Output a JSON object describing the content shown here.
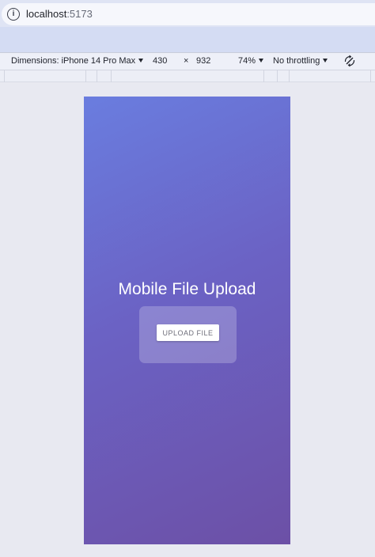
{
  "browser": {
    "url_host": "localhost",
    "url_port": ":5173",
    "info_icon": "info-icon"
  },
  "devtools": {
    "dimensions_label": "Dimensions: iPhone 14 Pro Max",
    "width": "430",
    "times": "×",
    "height": "932",
    "zoom": "74%",
    "throttling": "No throttling",
    "rotate_icon": "rotate-icon"
  },
  "app": {
    "title": "Mobile File Upload",
    "upload_button_label": "UPLOAD FILE",
    "gradient_start": "#6a7ddf",
    "gradient_end": "#6c50a6"
  }
}
